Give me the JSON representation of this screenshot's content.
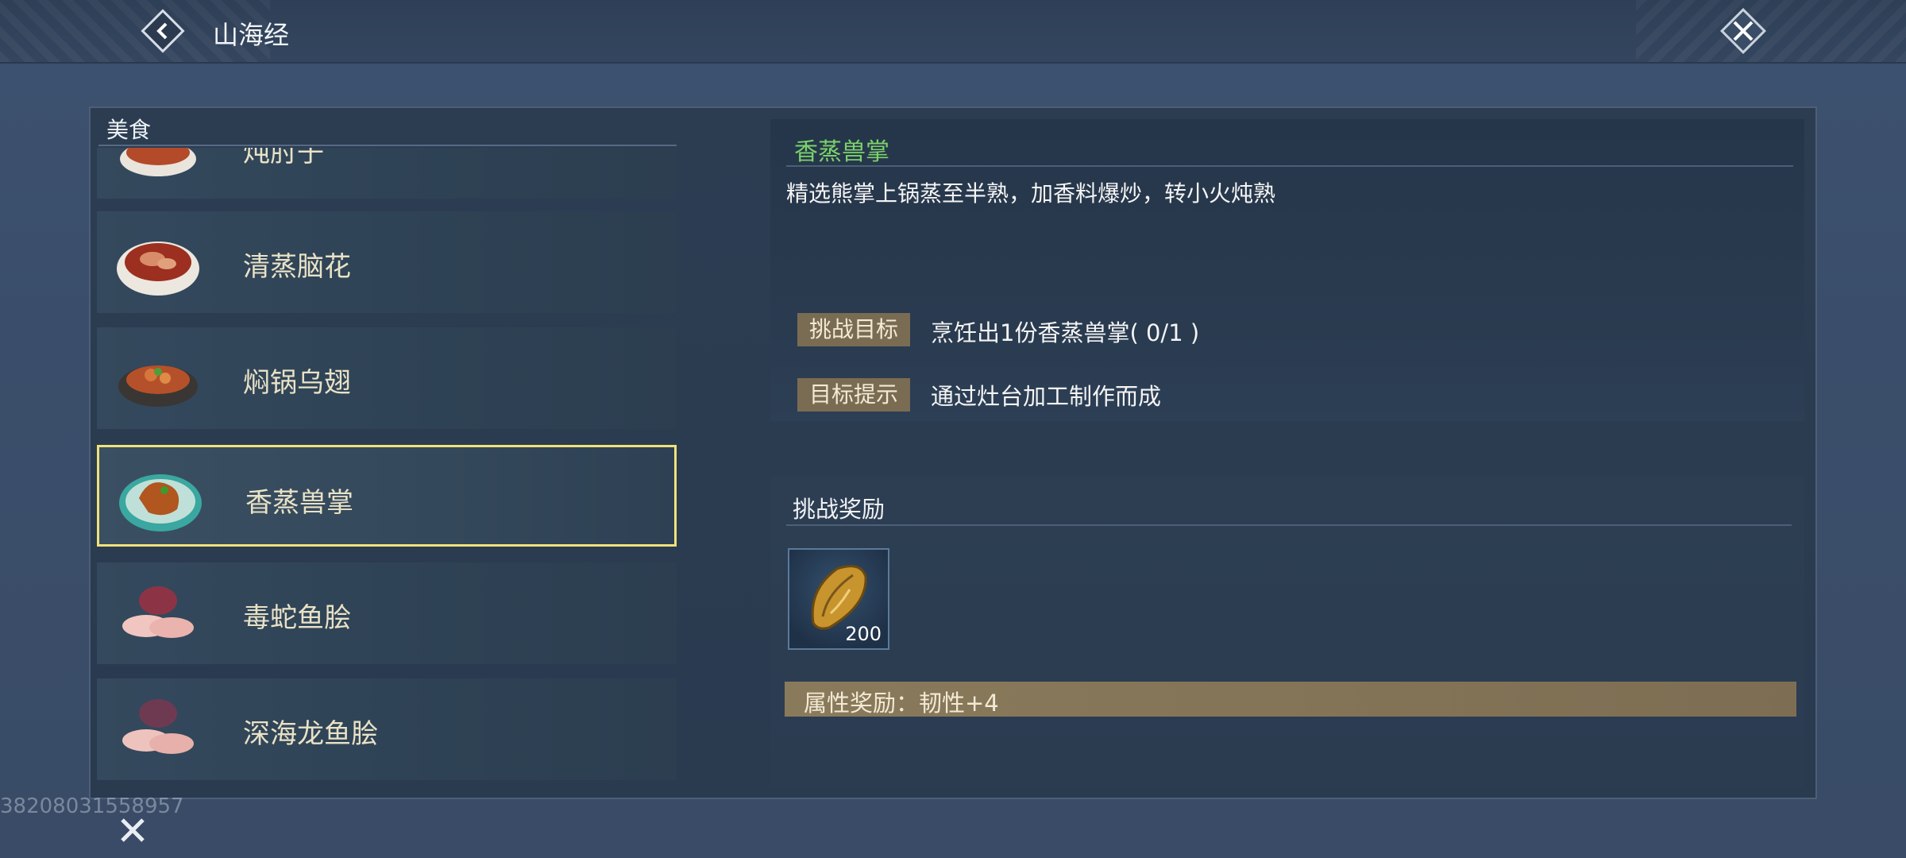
{
  "header": {
    "title": "山海经"
  },
  "category": {
    "label": "美食"
  },
  "dishes": [
    {
      "name": "炖肘子"
    },
    {
      "name": "清蒸脑花"
    },
    {
      "name": "焖锅乌翅"
    },
    {
      "name": "香蒸兽掌"
    },
    {
      "name": "毒蛇鱼脍"
    },
    {
      "name": "深海龙鱼脍"
    }
  ],
  "selected_index": 3,
  "detail": {
    "title": "香蒸兽掌",
    "description": "精选熊掌上锅蒸至半熟，加香料爆炒，转小火炖熟",
    "goal_tag": "挑战目标",
    "goal_text": "烹饪出1份香蒸兽掌( 0/1 )",
    "hint_tag": "目标提示",
    "hint_text": "通过灶台加工制作而成"
  },
  "rewards": {
    "title": "挑战奖励",
    "item_count": "200",
    "attribute_text": "属性奖励：韧性+4"
  },
  "footer": {
    "uid": "38208031558957"
  },
  "colors": {
    "accent_green": "#7bd36a",
    "selection_border": "#f0e27a",
    "tag_bg": "#7a6c53"
  }
}
